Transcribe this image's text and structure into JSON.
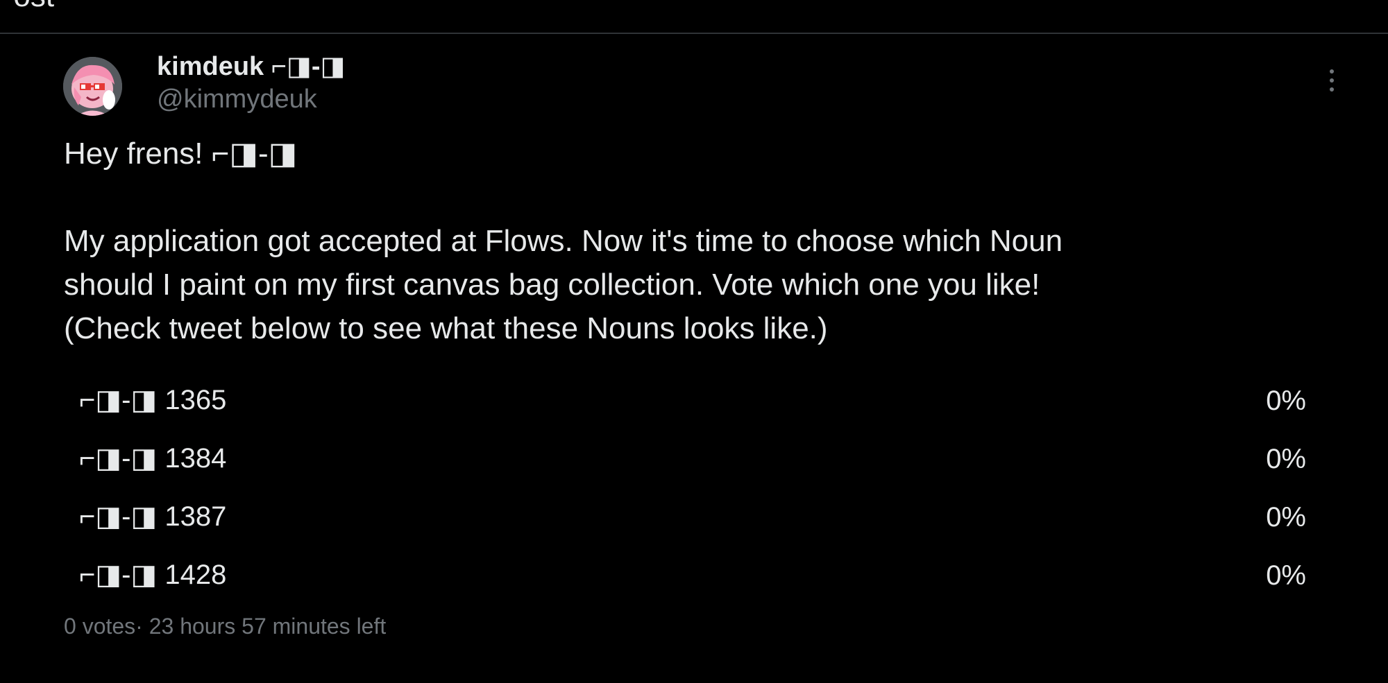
{
  "header": {
    "title": "Post"
  },
  "tweet": {
    "display_name": "kimdeuk ⌐◨-◨",
    "handle": "@kimmydeuk",
    "text": "Hey frens! ⌐◨-◨\n\nMy application got accepted at Flows. Now it's time to choose which Noun\nshould I paint on my first canvas bag collection. Vote which one you like!\n(Check tweet below to see what these Nouns looks like.)"
  },
  "poll": {
    "options": [
      {
        "label": "⌐◨-◨ 1365",
        "percent": "0%"
      },
      {
        "label": "⌐◨-◨ 1384",
        "percent": "0%"
      },
      {
        "label": "⌐◨-◨ 1387",
        "percent": "0%"
      },
      {
        "label": "⌐◨-◨ 1428",
        "percent": "0%"
      }
    ],
    "meta": "0 votes· 23 hours 57 minutes left"
  },
  "icons": {
    "more": "more-options-icon",
    "avatar": "avatar"
  },
  "colors": {
    "background": "#000000",
    "text_primary": "#e7e9ea",
    "text_secondary": "#71767b",
    "divider": "#2f3336"
  }
}
